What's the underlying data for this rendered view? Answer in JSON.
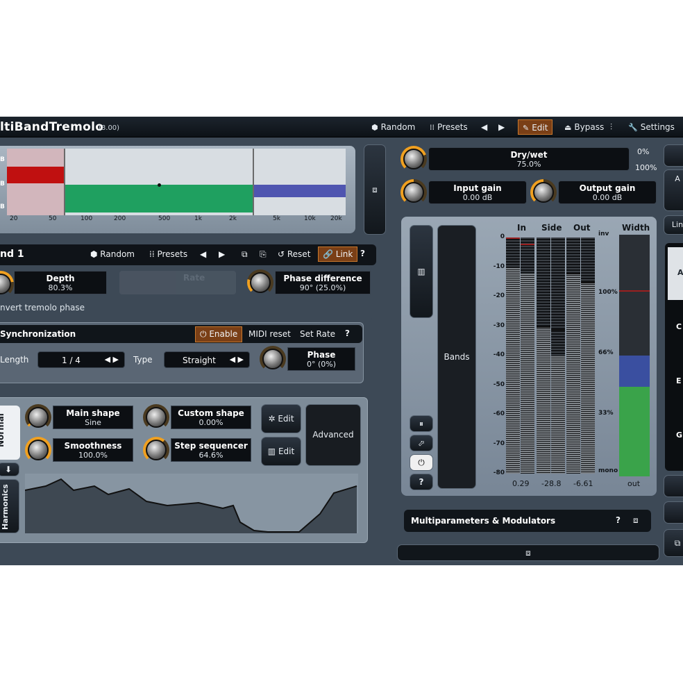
{
  "app": {
    "title": "ltiBandTremolo",
    "version": "(8.00)"
  },
  "toolbar": {
    "random": "Random",
    "presets": "Presets",
    "edit": "Edit",
    "bypass": "Bypass",
    "settings": "Settings"
  },
  "spectrum": {
    "freq_labels": [
      "20",
      "50",
      "100",
      "200",
      "500",
      "1k",
      "2k",
      "5k",
      "10k",
      "20k"
    ],
    "db_labels": [
      "B",
      "B",
      "B"
    ],
    "bands": [
      {
        "name": "band-1",
        "color": "#c01010"
      },
      {
        "name": "band-2",
        "color": "#1fa060"
      },
      {
        "name": "band-3",
        "color": "#4f55b0"
      }
    ]
  },
  "band_panel": {
    "title": "nd 1",
    "random": "Random",
    "presets": "Presets",
    "reset": "Reset",
    "link": "Link",
    "help": "?",
    "depth": {
      "label": "Depth",
      "value": "80.3%"
    },
    "rate": {
      "label": "Rate"
    },
    "phase_diff": {
      "label": "Phase difference",
      "value": "90° (25.0%)"
    },
    "invert": "nvert tremolo phase"
  },
  "sync": {
    "title": "Synchronization",
    "enable": "Enable",
    "midi_reset": "MIDI reset",
    "set_rate": "Set Rate",
    "help": "?",
    "length_label": "Length",
    "length_value": "1 / 4",
    "type_label": "Type",
    "type_value": "Straight",
    "phase": {
      "label": "Phase",
      "value": "0° (0%)"
    }
  },
  "shape": {
    "tab_normal": "Normal",
    "tab_harmonics": "Harmonics",
    "main_shape": {
      "label": "Main shape",
      "value": "Sine"
    },
    "custom_shape": {
      "label": "Custom shape",
      "value": "0.00%"
    },
    "smoothness": {
      "label": "Smoothness",
      "value": "100.0%"
    },
    "step_seq": {
      "label": "Step sequencer",
      "value": "64.6%"
    },
    "edit1": "Edit",
    "edit2": "Edit",
    "advanced": "Advanced"
  },
  "global": {
    "drywet": {
      "label": "Dry/wet",
      "value": "75.0%"
    },
    "drywet_min": "0%",
    "drywet_max": "100%",
    "input_gain": {
      "label": "Input gain",
      "value": "0.00 dB"
    },
    "output_gain": {
      "label": "Output gain",
      "value": "0.00 dB"
    }
  },
  "meters": {
    "bands_label": "Bands",
    "col_in": "In",
    "col_side": "Side",
    "col_out": "Out",
    "col_width": "Width",
    "scale": [
      "0",
      "-10",
      "-20",
      "-30",
      "-40",
      "-50",
      "-60",
      "-70",
      "-80"
    ],
    "width_scale": [
      "inv",
      "100%",
      "66%",
      "33%",
      "mono"
    ],
    "readout_in": "0.29",
    "readout_side": "-28.8",
    "readout_out": "-6.61",
    "readout_width": "out",
    "levels_db": {
      "in_l": -10,
      "in_r": -12,
      "side_l": -30,
      "side_r": -40,
      "out_l": -12,
      "out_r": -15
    },
    "peaks_db": {
      "in_l": 0,
      "in_r": -2,
      "side_l": -30,
      "side_r": -31,
      "out_l": -12,
      "out_r": -15
    },
    "width_level": {
      "green_pct": 66,
      "blue_pct": 80,
      "red_pct": 100
    }
  },
  "multiparams": {
    "title": "Multiparameters & Modulators",
    "help": "?"
  },
  "right_edge": {
    "tabs": [
      "A",
      "C",
      "E",
      "G"
    ],
    "lin": "Lin",
    "top_a": "A"
  },
  "colors": {
    "accent": "#f0a020",
    "bg": "#3d4956",
    "link": "#c8782d"
  }
}
